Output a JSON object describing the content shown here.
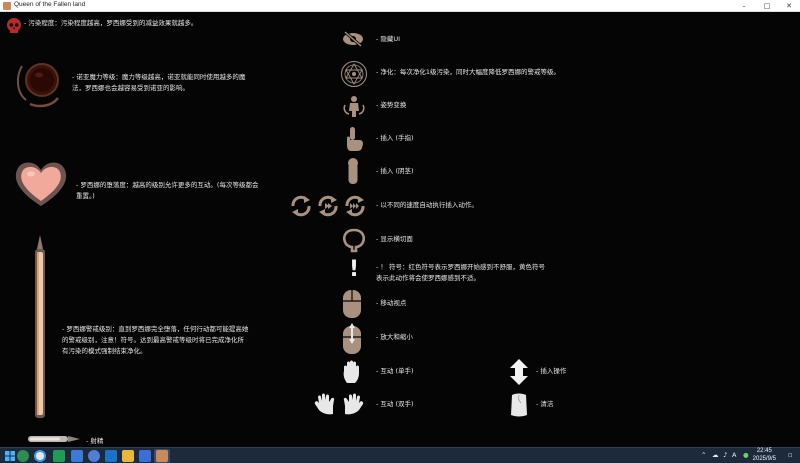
{
  "window": {
    "title": "Queen of the Fallen land"
  },
  "left_panel": {
    "pollution": "- 污染程度：污染程度越高，罗西娜受到的减益效果就越多。",
    "magic_level": "- 诺亚魔力等级：魔力等级越高，诺亚就能同时使用越多的魔法，罗西娜也会越容易受到诺亚的影响。",
    "corruption": "- 罗西娜的堕落度：越高的级别允许更多的互动。(每次等级都会重置。)",
    "alert_level": "- 罗西娜警戒级别：直到罗西娜完全堕落，任何行动都可能提高她的警戒级别，注意！符号。达到最高警戒等级时将已完成净化所有污染的模式强制结束净化。",
    "ejaculate": "- 射精"
  },
  "middle_panel": {
    "hide_ui": "- 隐藏UI",
    "purify": "- 净化：每次净化1级污染，同时大幅度降低罗西娜的警戒等级。",
    "pose": "- 姿势变换",
    "insert_finger": "- 插入 (手指)",
    "insert_penis": "- 插入 (阴茎)",
    "auto_speed": "- 以不同的速度自动执行插入动作。",
    "cross_section": "- 显示横切面",
    "exclamation_symbol": "!",
    "exclamation": "- ！ 符号：红色符号表示罗西娜开始感到不舒服，黄色符号表示此动作将会使罗西娜感到不适。",
    "move_view": "- 移动视点",
    "zoom": "- 放大和缩小",
    "interact_one": "- 互动 (单手)",
    "interact_two": "- 互动 (双手)"
  },
  "right_panel": {
    "insert_action": "- 插入操作",
    "clean": "- 清洁"
  },
  "taskbar": {
    "ime": "A",
    "time": "22:45",
    "date": "2025/9/5"
  },
  "colors": {
    "icon_tan": "#a8917e",
    "text": "#e8e8e8",
    "red": "#b52a2a"
  }
}
